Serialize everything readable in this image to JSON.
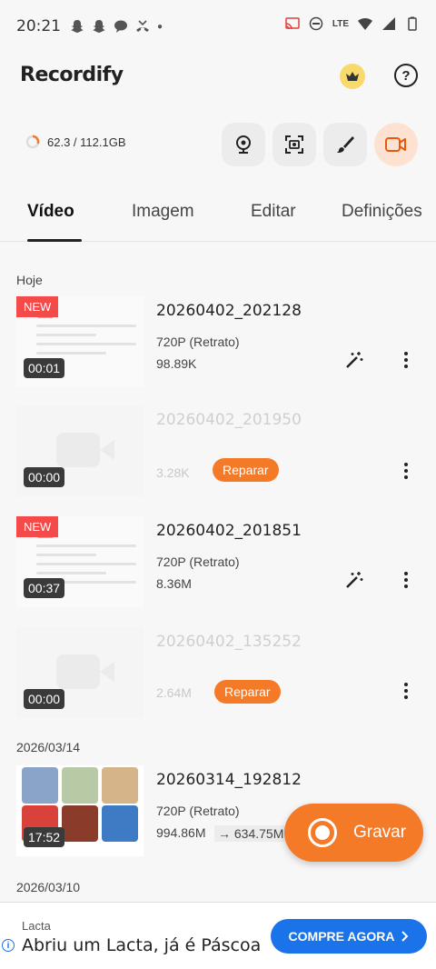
{
  "status_bar": {
    "time": "20:21",
    "network": "LTE"
  },
  "app": {
    "name": "Recordify"
  },
  "storage": {
    "text": "62.3 / 112.1GB"
  },
  "tabs": [
    {
      "label": "Vídeo",
      "active": true
    },
    {
      "label": "Imagem"
    },
    {
      "label": "Editar"
    },
    {
      "label": "Definições"
    }
  ],
  "sections": [
    {
      "label": "Hoje"
    },
    {
      "label": "2026/03/14"
    },
    {
      "label": "2026/03/10"
    }
  ],
  "items": [
    {
      "title": "20260402_202128",
      "badge": "NEW",
      "duration": "00:01",
      "resolution": "720P (Retrato)",
      "size": "98.89K"
    },
    {
      "title": "20260402_201950",
      "duration": "00:00",
      "size": "3.28K",
      "action": "Reparar"
    },
    {
      "title": "20260402_201851",
      "badge": "NEW",
      "duration": "00:37",
      "resolution": "720P (Retrato)",
      "size": "8.36M"
    },
    {
      "title": "20260402_135252",
      "duration": "00:00",
      "size": "2.64M",
      "action": "Reparar"
    },
    {
      "title": "20260314_192812",
      "duration": "17:52",
      "resolution": "720P (Retrato)",
      "size": "994.86M",
      "compressed": "634.75M"
    }
  ],
  "record_button": {
    "label": "Gravar"
  },
  "ad": {
    "brand": "Lacta",
    "text": "Abriu um Lacta, já é Páscoa",
    "cta": "COMPRE AGORA"
  },
  "colors": {
    "accent": "#f57a27",
    "new_badge": "#f54a4a",
    "ad_button": "#1a73e8"
  }
}
